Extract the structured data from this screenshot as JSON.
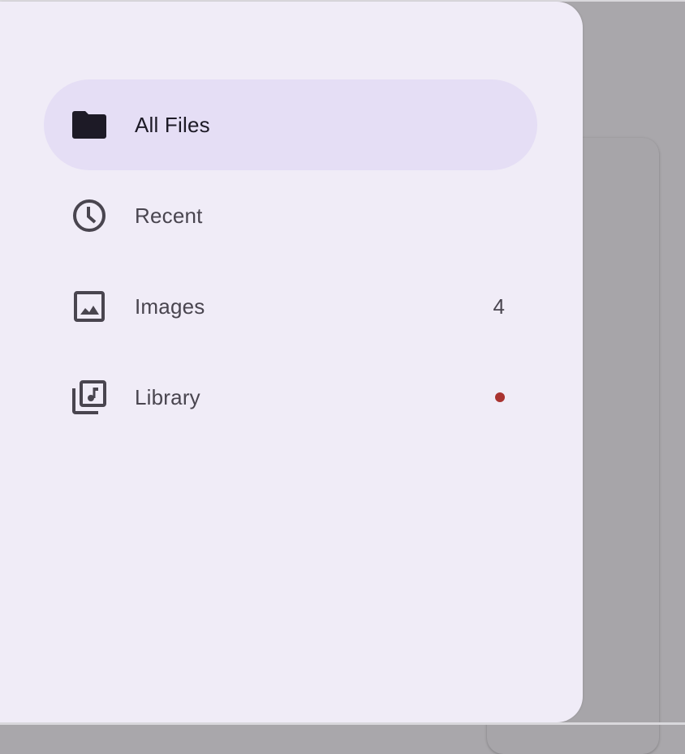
{
  "colors": {
    "drawer_bg": "#f0ecf7",
    "active_bg": "#e5def5",
    "icon": "#49454f",
    "active_icon": "#1d1a26",
    "notification_dot": "#a93330"
  },
  "nav": {
    "items": [
      {
        "label": "All Files",
        "icon": "folder-icon",
        "active": true
      },
      {
        "label": "Recent",
        "icon": "clock-icon",
        "active": false
      },
      {
        "label": "Images",
        "icon": "image-icon",
        "active": false,
        "badge": "4"
      },
      {
        "label": "Library",
        "icon": "library-music-icon",
        "active": false,
        "dot": true
      }
    ]
  }
}
